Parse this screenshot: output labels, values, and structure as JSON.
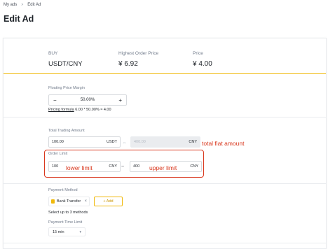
{
  "breadcrumb": {
    "parent": "My ads",
    "separator": ">",
    "current": "Edit Ad"
  },
  "page_title": "Edit Ad",
  "summary": {
    "side": "BUY",
    "pair": "USDT/CNY",
    "highest_label": "Highest Order Price",
    "highest_value": "¥ 6.92",
    "price_label": "Price",
    "price_value": "¥ 4.00"
  },
  "floating": {
    "label": "Floating Price Margin",
    "minus": "−",
    "value": "50.00%",
    "plus": "+",
    "formula_label": "Pricing formula",
    "formula_value": "6.00 * 50.00% ≈ 4.00"
  },
  "total": {
    "label": "Total Trading Amount",
    "amount": "100.00",
    "amount_unit": "USDT",
    "swap_icon": "⇔",
    "fiat_placeholder": "400.00",
    "fiat_unit": "CNY",
    "annotation": "total fiat amount"
  },
  "order_limit": {
    "label": "Order Limit",
    "lower_value": "100",
    "lower_annotation": "lower limit",
    "lower_unit": "CNY",
    "tilde": "~",
    "upper_value": "400",
    "upper_annotation": "upper limit",
    "upper_unit": "CNY"
  },
  "payment": {
    "label": "Payment Method",
    "selected": "Bank Transfer",
    "remove": "×",
    "add_label": "+ Add",
    "hint": "Select up to 3 methods"
  },
  "time_limit": {
    "label": "Payment Time Limit",
    "value": "15 min",
    "chevron": "▾"
  },
  "colors": {
    "accent": "#f0b90b",
    "annotation": "#d9381e",
    "text": "#1e2329",
    "muted": "#707a8a"
  }
}
